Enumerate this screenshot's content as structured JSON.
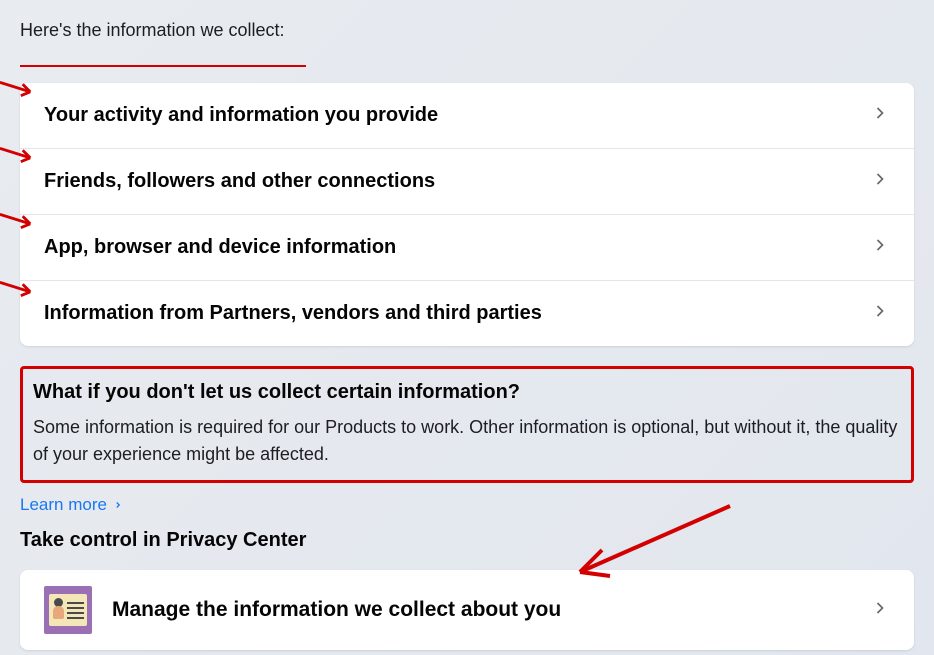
{
  "heading": "Here's the information we collect:",
  "items": [
    {
      "label": "Your activity and information you provide"
    },
    {
      "label": "Friends, followers and other connections"
    },
    {
      "label": "App, browser and device information"
    },
    {
      "label": "Information from Partners, vendors and third parties"
    }
  ],
  "callout": {
    "title": "What if you don't let us collect certain information?",
    "body": "Some information is required for our Products to work. Other information is optional, but without it, the quality of your experience might be affected."
  },
  "learn_more": "Learn more",
  "section_title": "Take control in Privacy Center",
  "action": {
    "label": "Manage the information we collect about you"
  }
}
